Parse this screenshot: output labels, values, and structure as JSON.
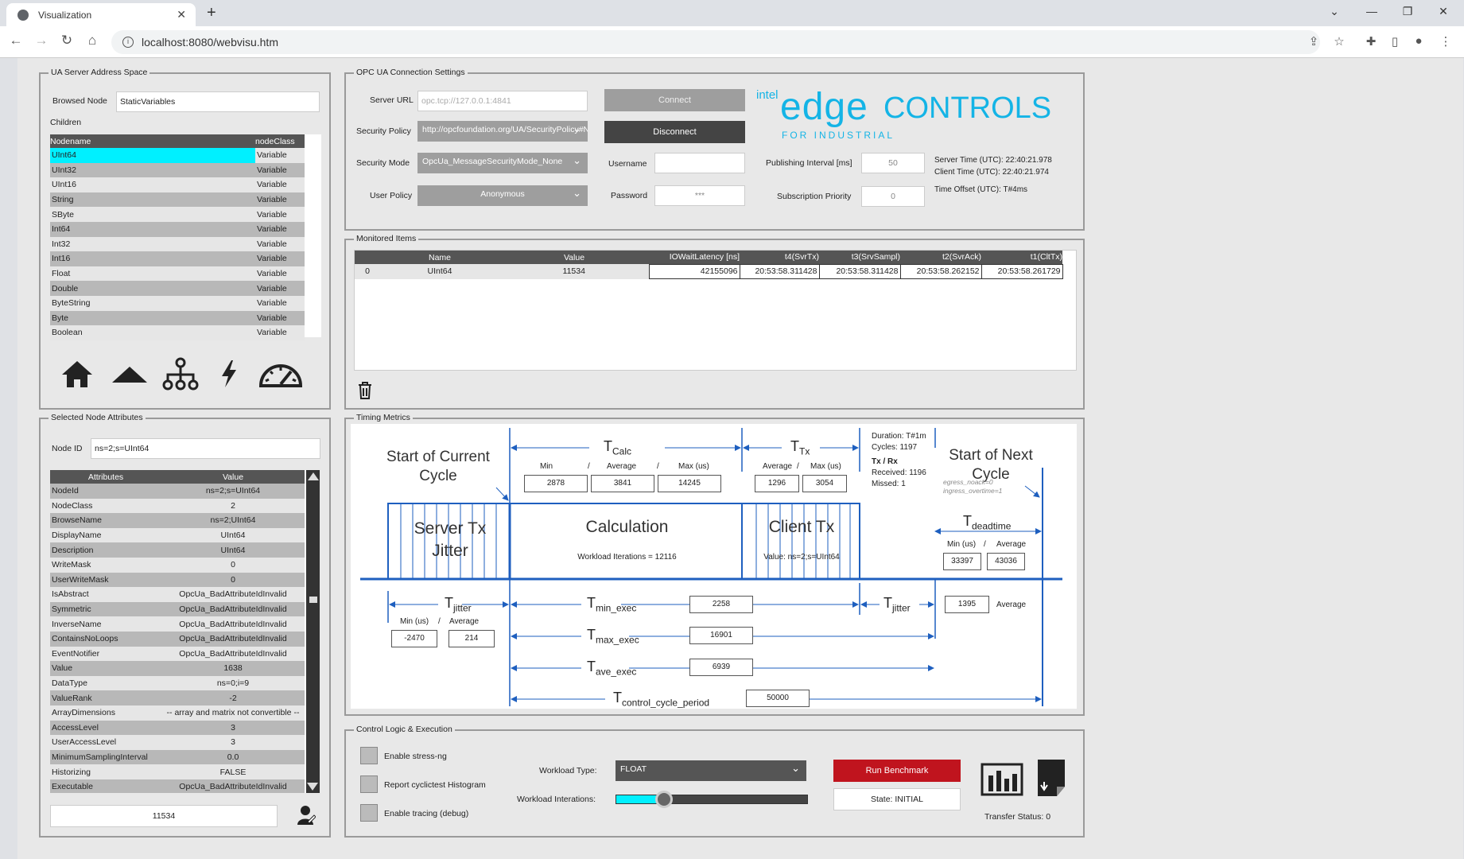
{
  "browser": {
    "tab_title": "Visualization",
    "url": "localhost:8080/webvisu.htm"
  },
  "address_space": {
    "title": "UA Server Address Space",
    "browsed_node_label": "Browsed Node",
    "browsed_node_value": "StaticVariables",
    "children_label": "Children",
    "headers": [
      "Nodename",
      "nodeClass"
    ],
    "rows": [
      [
        "UInt64",
        "Variable"
      ],
      [
        "UInt32",
        "Variable"
      ],
      [
        "UInt16",
        "Variable"
      ],
      [
        "String",
        "Variable"
      ],
      [
        "SByte",
        "Variable"
      ],
      [
        "Int64",
        "Variable"
      ],
      [
        "Int32",
        "Variable"
      ],
      [
        "Int16",
        "Variable"
      ],
      [
        "Float",
        "Variable"
      ],
      [
        "Double",
        "Variable"
      ],
      [
        "ByteString",
        "Variable"
      ],
      [
        "Byte",
        "Variable"
      ],
      [
        "Boolean",
        "Variable"
      ]
    ]
  },
  "connection": {
    "title": "OPC UA Connection Settings",
    "server_url_label": "Server URL",
    "server_url_value": "opc.tcp://127.0.0.1:4841",
    "security_policy_label": "Security Policy",
    "security_policy_value": "http://opcfoundation.org/UA/SecurityPolicy#None",
    "security_mode_label": "Security Mode",
    "security_mode_value": "OpcUa_MessageSecurityMode_None",
    "user_policy_label": "User Policy",
    "user_policy_value": "Anonymous",
    "connect_label": "Connect",
    "disconnect_label": "Disconnect",
    "username_label": "Username",
    "username_value": "",
    "password_label": "Password",
    "password_value": "***",
    "publishing_label": "Publishing Interval [ms]",
    "publishing_value": "50",
    "priority_label": "Subscription Priority",
    "priority_value": "0",
    "server_time": "Server Time (UTC): 22:40:21.978",
    "client_time": "Client Time (UTC): 22:40:21.974",
    "time_offset": "Time Offset (UTC): T#4ms",
    "logo_intel": "intel",
    "logo_edge": "edge",
    "logo_controls": "CONTROLS",
    "logo_sub": "FOR INDUSTRIAL"
  },
  "monitored": {
    "title": "Monitored Items",
    "headers": [
      "Name",
      "Value",
      "IOWaitLatency [ns]",
      "t4(SvrTx)",
      "t3(SrvSampl)",
      "t2(SvrAck)",
      "t1(CltTx)"
    ],
    "row_index": "0",
    "row": [
      "UInt64",
      "11534",
      "42155096",
      "20:53:58.311428",
      "20:53:58.311428",
      "20:53:58.262152",
      "20:53:58.261729"
    ]
  },
  "attributes": {
    "title": "Selected Node Attributes",
    "node_id_label": "Node ID",
    "node_id_value": "ns=2;s=UInt64",
    "headers": [
      "Attributes",
      "Value"
    ],
    "rows": [
      [
        "NodeId",
        "ns=2;s=UInt64"
      ],
      [
        "NodeClass",
        "2"
      ],
      [
        "BrowseName",
        "ns=2;UInt64"
      ],
      [
        "DisplayName",
        "UInt64"
      ],
      [
        "Description",
        "UInt64"
      ],
      [
        "WriteMask",
        "0"
      ],
      [
        "UserWriteMask",
        "0"
      ],
      [
        "IsAbstract",
        "OpcUa_BadAttributeIdInvalid"
      ],
      [
        "Symmetric",
        "OpcUa_BadAttributeIdInvalid"
      ],
      [
        "InverseName",
        "OpcUa_BadAttributeIdInvalid"
      ],
      [
        "ContainsNoLoops",
        "OpcUa_BadAttributeIdInvalid"
      ],
      [
        "EventNotifier",
        "OpcUa_BadAttributeIdInvalid"
      ],
      [
        "Value",
        "1638"
      ],
      [
        "DataType",
        "ns=0;i=9"
      ],
      [
        "ValueRank",
        "-2"
      ],
      [
        "ArrayDimensions",
        "-- array and matrix not convertible --"
      ],
      [
        "AccessLevel",
        "3"
      ],
      [
        "UserAccessLevel",
        "3"
      ],
      [
        "MinimumSamplingInterval",
        "0.0"
      ],
      [
        "Historizing",
        "FALSE"
      ],
      [
        "Executable",
        "OpcUa_BadAttributeIdInvalid"
      ]
    ],
    "value_display": "11534"
  },
  "timing": {
    "title": "Timing Metrics",
    "start_current": "Start of Current Cycle",
    "start_next": "Start of Next Cycle",
    "server_tx_jitter": "Server Tx Jitter",
    "calculation": "Calculation",
    "workload_iterations": "Workload Iterations = 12116",
    "client_tx": "Client Tx",
    "client_value": "Value: ns=2;s=UInt64",
    "tcalc_min_label": "Min",
    "tcalc_avg_label": "Average",
    "tcalc_max_label": "Max  (us)",
    "tcalc_min": "2878",
    "tcalc_avg": "3841",
    "tcalc_max": "14245",
    "ttx_avg_label": "Average",
    "ttx_max_label": "Max (us)",
    "ttx_avg": "1296",
    "ttx_max": "3054",
    "duration": "Duration: T#1m",
    "cycles": "Cycles: 1197",
    "txrx": "Tx / Rx",
    "received": "Received: 1196",
    "missed": "Missed: 1",
    "egress": "egress_noack=0",
    "ingress": "ingress_overtime=1",
    "tdead_min_label": "Min (us)",
    "tdead_avg_label": "Average",
    "tdead_min": "33397",
    "tdead_avg": "43036",
    "tjit_min_label": "Min (us)",
    "tjit_avg_label": "Average",
    "tjit_min": "-2470",
    "tjit_avg": "214",
    "tmin_exec": "2258",
    "tmax_exec": "16901",
    "tave_exec": "6939",
    "tperiod": "50000",
    "tjit2": "1395",
    "tjit2_label": "Average"
  },
  "control": {
    "title": "Control Logic & Execution",
    "stress": "Enable stress-ng",
    "histogram": "Report cyclictest Histogram",
    "tracing": "Enable tracing (debug)",
    "workload_type_label": "Workload Type:",
    "workload_type_value": "FLOAT",
    "workload_iter_label": "Workload Interations:",
    "workload_iter_fraction": 0.25,
    "run_label": "Run Benchmark",
    "state": "State: INITIAL",
    "transfer_status": "Transfer Status: 0"
  },
  "colors": {
    "accent_blue": "#1e5fbf",
    "selected_row": "#00f0ff",
    "run_button": "#c0141e",
    "logo_blue": "#14b4e6"
  }
}
